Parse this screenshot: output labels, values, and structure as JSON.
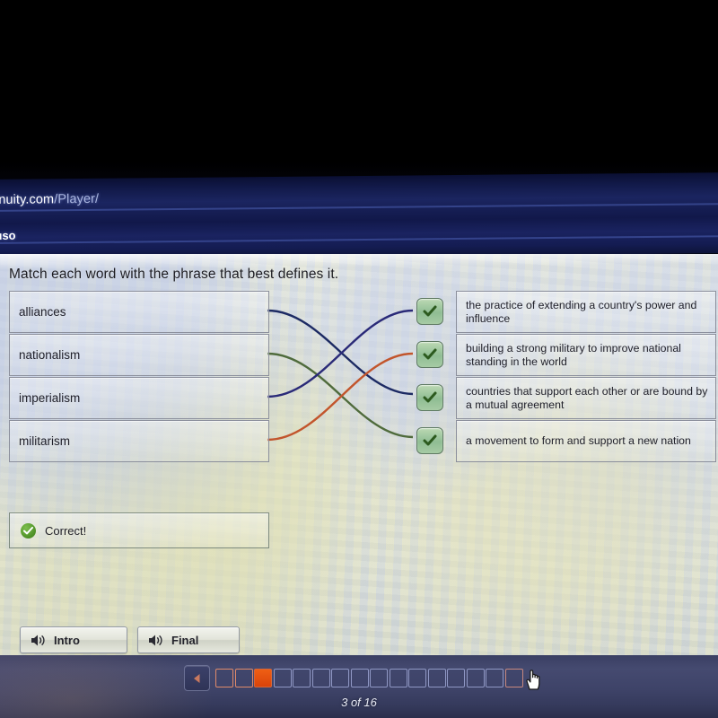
{
  "browser": {
    "url_bold": "enuity.com",
    "url_dim": "/Player/",
    "tab_label": "fuso"
  },
  "page": {
    "prompt": "Match each word with the phrase that best defines it.",
    "words": [
      {
        "label": "alliances"
      },
      {
        "label": "nationalism"
      },
      {
        "label": "imperialism"
      },
      {
        "label": "militarism"
      }
    ],
    "definitions": [
      {
        "text": "the practice of extending a country's power and influence"
      },
      {
        "text": "building a strong military to improve national standing in the world"
      },
      {
        "text": "countries that support each other or are bound by a mutual agreement"
      },
      {
        "text": "a movement to form and support a new nation"
      }
    ],
    "check_icon": "check-icon",
    "matches": [
      {
        "from": 0,
        "to": 2,
        "color": "#1c2a63"
      },
      {
        "from": 1,
        "to": 3,
        "color": "#4f6b3c"
      },
      {
        "from": 2,
        "to": 0,
        "color": "#2a2a78"
      },
      {
        "from": 3,
        "to": 1,
        "color": "#c2552c"
      }
    ],
    "feedback": {
      "icon": "check-circle-icon",
      "text": "Correct!"
    },
    "audio_buttons": [
      {
        "label": "Intro",
        "icon": "speaker-icon"
      },
      {
        "label": "Final",
        "icon": "speaker-icon"
      }
    ]
  },
  "nav": {
    "back_icon": "triangle-left-icon",
    "counter": "3 of 16",
    "total_questions": 16,
    "current_question": 3,
    "completed": 2,
    "cursor_icon": "pointer-hand-cursor",
    "colors": {
      "current_fill": "#ef5f14",
      "completed_outline": "#e08a6a",
      "pending_outline": "#8f97c4"
    }
  }
}
